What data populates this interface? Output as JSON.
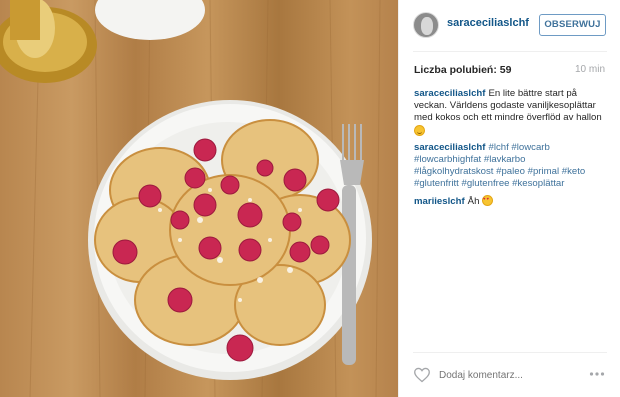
{
  "post": {
    "username": "saraceciliaslchf",
    "follow_label": "OBSERWUJ",
    "likes_label": "Liczba polubień:",
    "likes_count": "59",
    "time_ago": "10 min",
    "caption_author": "saraceciliaslchf",
    "caption_text": "En lite bättre start på veckan. Världens godaste vaniljkesoplättar med kokos och ett mindre överflöd av hallon",
    "hashtags": [
      "#lchf",
      "#lowcarb",
      "#lowcarbhighfat",
      "#lavkarbo",
      "#lågkolhydratskost",
      "#paleo",
      "#primal",
      "#keto",
      "#glutenfritt",
      "#glutenfree",
      "#kesoplättar"
    ],
    "comment_author": "mariieslchf",
    "comment_text": "Åh",
    "comment_placeholder": "Dodaj komentarz...",
    "icons": {
      "like": "heart-outline-icon",
      "more": "more-options-icon"
    }
  }
}
